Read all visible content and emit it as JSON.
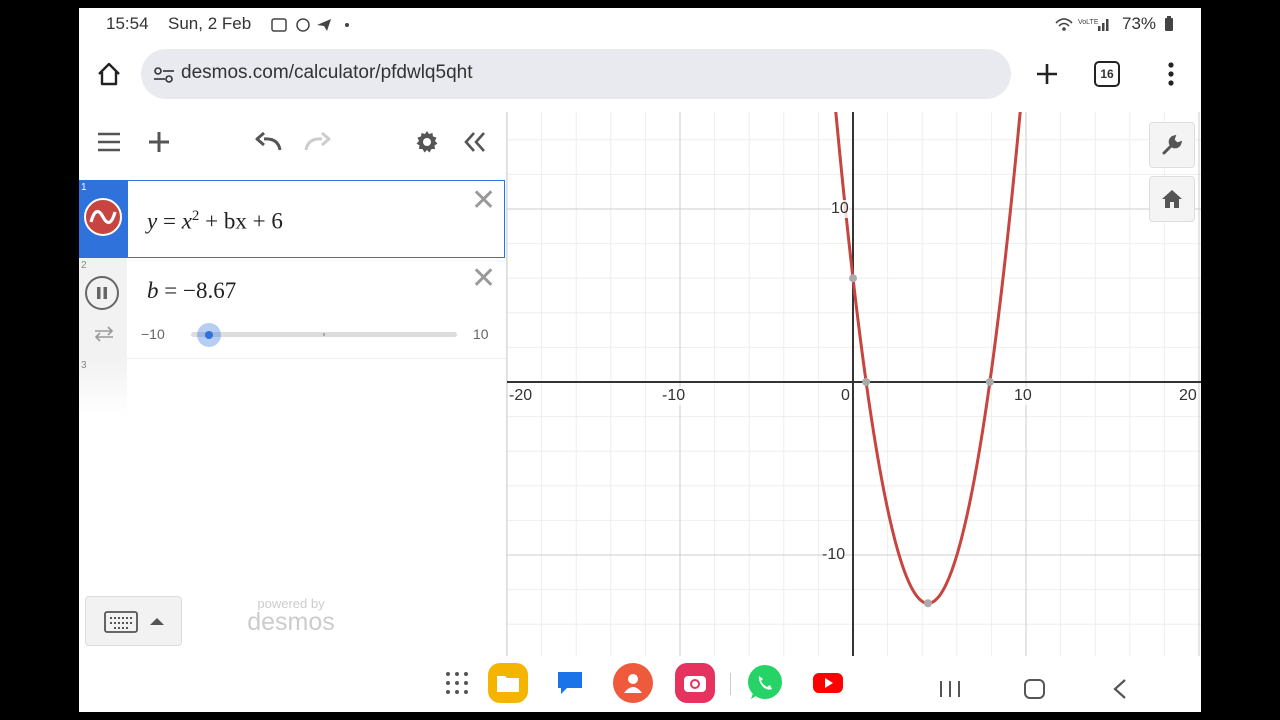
{
  "status_bar": {
    "time": "15:54",
    "date": "Sun, 2 Feb",
    "battery": "73%"
  },
  "browser": {
    "url": "desmos.com/calculator/pfdwlq5qht",
    "tab_count": "16"
  },
  "expressions": [
    {
      "index": "1",
      "lhs": "y",
      "base": "x",
      "exponent": "2",
      "rest": "+ bx + 6"
    },
    {
      "index": "2",
      "lhs": "b",
      "value": "−8.67",
      "slider_min": "−10",
      "slider_max": "10",
      "slider_fraction": 0.0665
    },
    {
      "index": "3"
    }
  ],
  "branding": {
    "powered_by": "powered by",
    "name": "desmos"
  },
  "graph": {
    "x_ticks": [
      "-20",
      "-10",
      "0",
      "10",
      "20"
    ],
    "y_ticks": [
      "10",
      "-10"
    ],
    "curve_color": "#c74440",
    "b_value": -8.67
  },
  "colors": {
    "accent": "#2f72dc",
    "curve": "#c74440"
  },
  "nav_apps": [
    "apps-grid-icon",
    "files-icon",
    "messages-icon",
    "contacts-icon",
    "camera-icon",
    "whatsapp-icon",
    "youtube-icon"
  ]
}
